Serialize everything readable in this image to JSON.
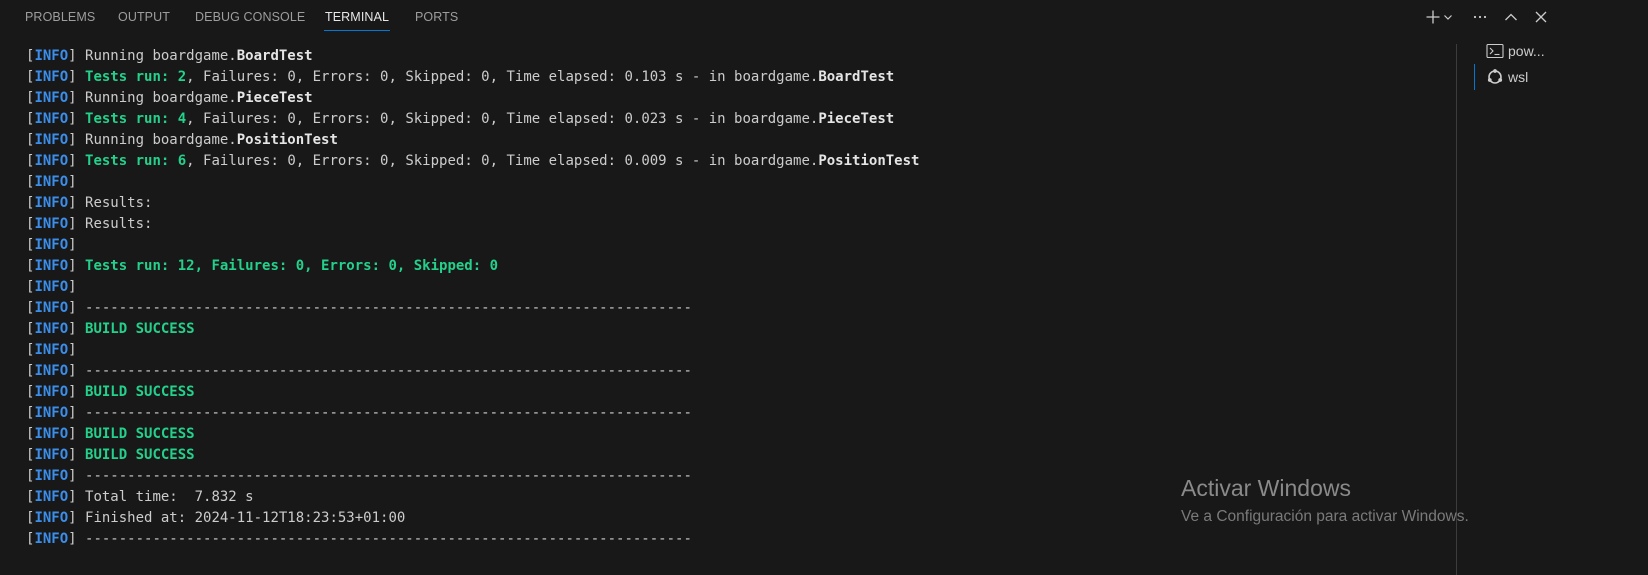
{
  "tabs": {
    "problems": "PROBLEMS",
    "output": "OUTPUT",
    "debug_console": "DEBUG CONSOLE",
    "terminal": "TERMINAL",
    "ports": "PORTS"
  },
  "active_tab": "TERMINAL",
  "terminals": [
    {
      "label": "pow...",
      "icon": "terminal-prompt-icon"
    },
    {
      "label": "wsl",
      "icon": "linux-icon"
    }
  ],
  "terminal_lines": [
    {
      "tag": "INFO",
      "segments": [
        {
          "text": "Running boardgame.",
          "style": "normal"
        },
        {
          "text": "BoardTest",
          "style": "bold-white"
        }
      ]
    },
    {
      "tag": "INFO",
      "segments": [
        {
          "text": "Tests run: 2",
          "style": "green-bold"
        },
        {
          "text": ", Failures: 0, Errors: 0, Skipped: 0, Time elapsed: 0.103 s - in boardgame.",
          "style": "normal"
        },
        {
          "text": "BoardTest",
          "style": "bold-white"
        }
      ]
    },
    {
      "tag": "INFO",
      "segments": [
        {
          "text": "Running boardgame.",
          "style": "normal"
        },
        {
          "text": "PieceTest",
          "style": "bold-white"
        }
      ]
    },
    {
      "tag": "INFO",
      "segments": [
        {
          "text": "Tests run: 4",
          "style": "green-bold"
        },
        {
          "text": ", Failures: 0, Errors: 0, Skipped: 0, Time elapsed: 0.023 s - in boardgame.",
          "style": "normal"
        },
        {
          "text": "PieceTest",
          "style": "bold-white"
        }
      ]
    },
    {
      "tag": "INFO",
      "segments": [
        {
          "text": "Running boardgame.",
          "style": "normal"
        },
        {
          "text": "PositionTest",
          "style": "bold-white"
        }
      ]
    },
    {
      "tag": "INFO",
      "segments": [
        {
          "text": "Tests run: 6",
          "style": "green-bold"
        },
        {
          "text": ", Failures: 0, Errors: 0, Skipped: 0, Time elapsed: 0.009 s - in boardgame.",
          "style": "normal"
        },
        {
          "text": "PositionTest",
          "style": "bold-white"
        }
      ]
    },
    {
      "tag": "INFO",
      "segments": []
    },
    {
      "tag": "INFO",
      "segments": [
        {
          "text": "Results:",
          "style": "normal"
        }
      ]
    },
    {
      "tag": "INFO",
      "segments": [
        {
          "text": "Results:",
          "style": "normal"
        }
      ]
    },
    {
      "tag": "INFO",
      "segments": []
    },
    {
      "tag": "INFO",
      "segments": [
        {
          "text": "Tests run: 12, Failures: 0, Errors: 0, Skipped: 0",
          "style": "green-bold"
        }
      ]
    },
    {
      "tag": "INFO",
      "segments": []
    },
    {
      "tag": "INFO",
      "segments": [
        {
          "text": "------------------------------------------------------------------------",
          "style": "normal"
        }
      ]
    },
    {
      "tag": "INFO",
      "segments": [
        {
          "text": "BUILD SUCCESS",
          "style": "green-bold"
        }
      ]
    },
    {
      "tag": "INFO",
      "segments": []
    },
    {
      "tag": "INFO",
      "segments": [
        {
          "text": "------------------------------------------------------------------------",
          "style": "normal"
        }
      ]
    },
    {
      "tag": "INFO",
      "segments": [
        {
          "text": "BUILD SUCCESS",
          "style": "green-bold"
        }
      ]
    },
    {
      "tag": "INFO",
      "segments": [
        {
          "text": "------------------------------------------------------------------------",
          "style": "normal"
        }
      ]
    },
    {
      "tag": "INFO",
      "segments": [
        {
          "text": "BUILD SUCCESS",
          "style": "green-bold"
        }
      ]
    },
    {
      "tag": "INFO",
      "segments": [
        {
          "text": "BUILD SUCCESS",
          "style": "green-bold"
        }
      ]
    },
    {
      "tag": "INFO",
      "segments": [
        {
          "text": "------------------------------------------------------------------------",
          "style": "normal"
        }
      ]
    },
    {
      "tag": "INFO",
      "segments": [
        {
          "text": "Total time:  7.832 s",
          "style": "normal"
        }
      ]
    },
    {
      "tag": "INFO",
      "segments": [
        {
          "text": "Finished at: 2024-11-12T18:23:53+01:00",
          "style": "normal"
        }
      ]
    },
    {
      "tag": "INFO",
      "segments": [
        {
          "text": "------------------------------------------------------------------------",
          "style": "normal"
        }
      ]
    }
  ],
  "watermark": {
    "title": "Activar Windows",
    "subtitle": "Ve a Configuración para activar Windows."
  },
  "actions": [
    {
      "name": "new-terminal-button",
      "icon": "plus-icon"
    },
    {
      "name": "launch-profile-button",
      "icon": "chevron-down-icon"
    },
    {
      "name": "more-actions-button",
      "icon": "ellipsis-icon"
    },
    {
      "name": "maximize-panel-button",
      "icon": "chevron-up-icon"
    },
    {
      "name": "close-panel-button",
      "icon": "close-icon"
    }
  ],
  "colors": {
    "background": "#181818",
    "info_tag": "#3b8eea",
    "success_green": "#23d18b",
    "text": "#cccccc",
    "active_tab_underline": "#0078d4"
  }
}
